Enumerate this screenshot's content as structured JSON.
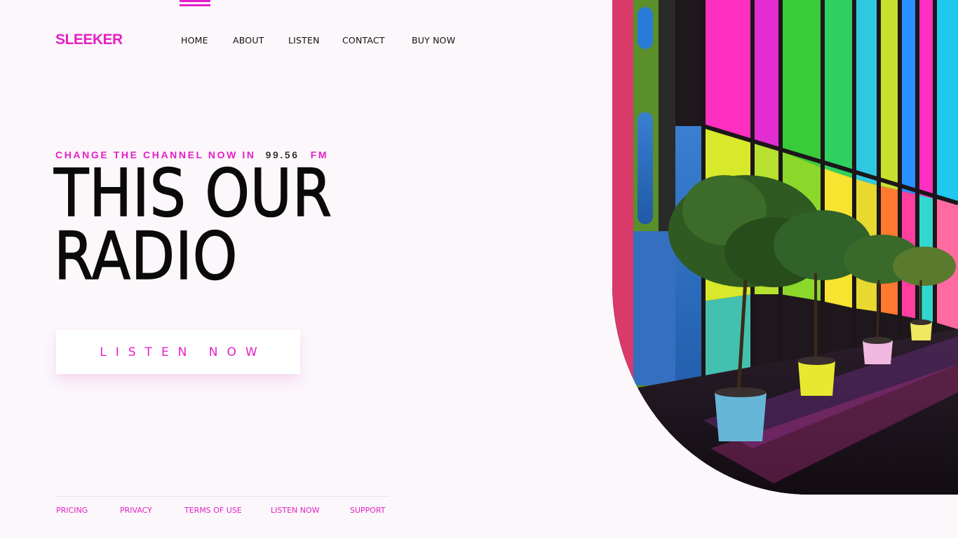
{
  "brand": {
    "name": "SLEEKER",
    "accent_color": "#e61fc6"
  },
  "nav": {
    "items": [
      {
        "label": "HOME"
      },
      {
        "label": "ABOUT"
      },
      {
        "label": "LISTEN"
      },
      {
        "label": "CONTACT"
      },
      {
        "label": "BUY NOW"
      }
    ]
  },
  "hero": {
    "tagline": "CHANGE THE CHANNEL NOW IN",
    "frequency": "99.56",
    "band": "FM",
    "headline_line1": "THIS OUR",
    "headline_line2": "RADIO",
    "cta_label": "LISTEN NOW",
    "image_icon": "colorful-glass-corridor-photo"
  },
  "footer": {
    "links": [
      {
        "label": "PRICING"
      },
      {
        "label": "PRIVACY"
      },
      {
        "label": "TERMS OF USE"
      },
      {
        "label": "LISTEN NOW"
      },
      {
        "label": "SUPPORT"
      }
    ]
  },
  "colors": {
    "background": "#fbf7fb",
    "text": "#0a0a0a",
    "accent": "#e61fc6"
  }
}
